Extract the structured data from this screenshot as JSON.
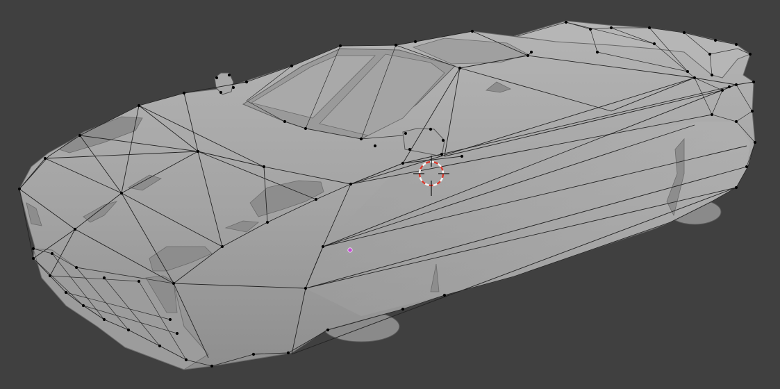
{
  "viewport": {
    "mode": "edit-mode-wireframe-overlay",
    "object": "car-mesh",
    "background_color": "#404040",
    "surface_color": "#a8a8a8",
    "wire_color": "#232323",
    "vertex_color": "#000000",
    "cursor_color": "#d83a2e",
    "origin_color": "#c54bd6"
  },
  "icons": {
    "cursor": "3d-cursor-icon",
    "origin": "object-origin-icon"
  }
}
